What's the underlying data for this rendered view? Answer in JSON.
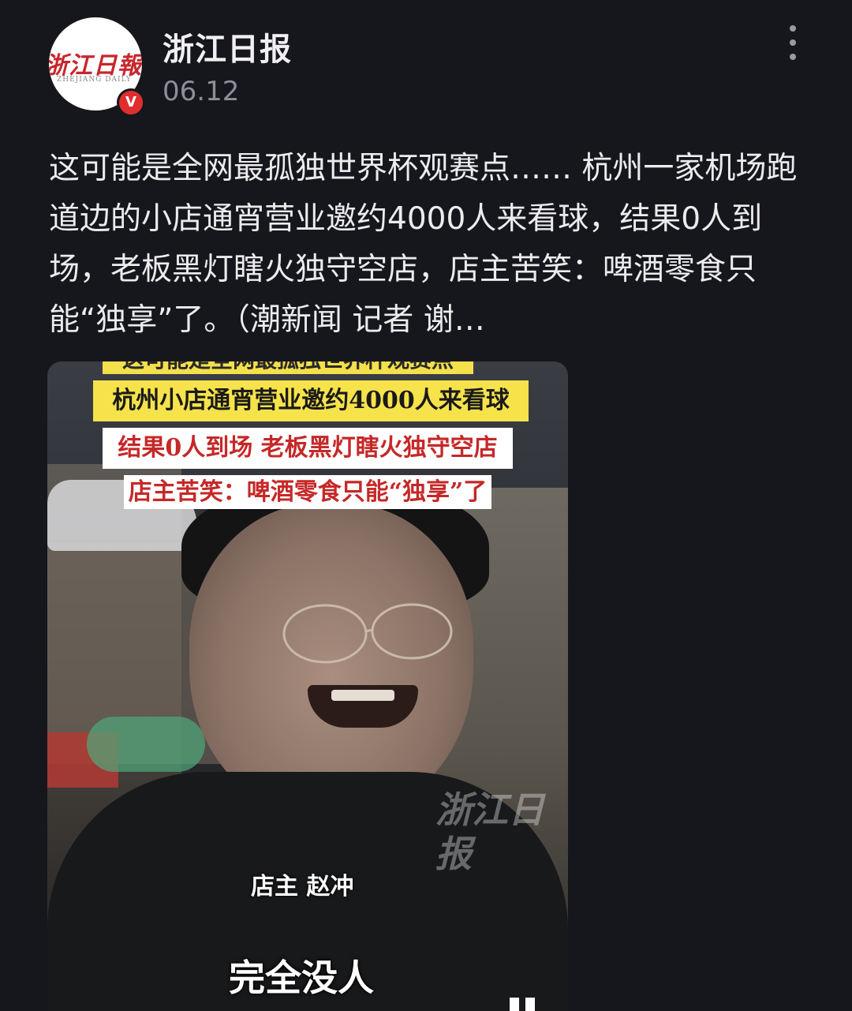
{
  "account": {
    "name": "浙江日报",
    "date": "06.12",
    "avatar_logo": "浙江日報",
    "avatar_sub": "ZHEJIANG DAILY",
    "verified_mark": "V"
  },
  "post": {
    "text": "这可能是全网最孤独世界杯观赛点…… 杭州一家机场跑道边的小店通宵营业邀约4000人来看球，结果0人到场，老板黑灯瞎火独守空店，店主苦笑：啤酒零食只能“独享”了。（潮新闻 记者 谢…"
  },
  "video": {
    "caption_top": "这可能是全网最孤独世界杯观赛点",
    "caption_yellow": "杭州小店通宵营业邀约4000人来看球",
    "caption_red_1": "结果0人到场 老板黑灯瞎火独守空店",
    "caption_red_2": "店主苦笑：啤酒零食只能“独享”了",
    "watermark": "浙江日报",
    "name_caption": "店主  赵冲",
    "main_caption": "完全没人"
  },
  "colors": {
    "background": "#16171c",
    "verified": "#e02e2e",
    "caption_yellow": "#f6e34b",
    "caption_red": "#c62828"
  }
}
